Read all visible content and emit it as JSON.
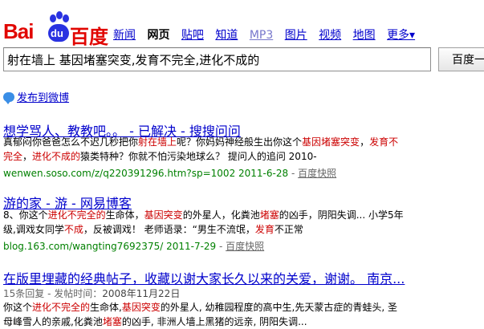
{
  "logo": {
    "bai": "Bai",
    "du": "du",
    "cn": "百度"
  },
  "nav": {
    "items": [
      "新闻",
      "网页",
      "贴吧",
      "知道",
      "MP3",
      "图片",
      "视频",
      "地图"
    ],
    "current": "网页",
    "more": "更多▾"
  },
  "search": {
    "query": "射在墙上 基因堵塞突变,发育不完全,进化不成的",
    "button": "百度一下"
  },
  "weibo": {
    "label": "发布到微博"
  },
  "results": [
    {
      "title": "想学骂人、教教吧。。 - 已解决 - 搜搜问问",
      "lines": [
        [
          [
            "真郁闷你爸爸怎么不迟几秒把你",
            ""
          ],
          [
            "射在墙上",
            "em"
          ],
          [
            "呢？你妈妈神经般生出你这个",
            ""
          ],
          [
            "基因堵塞突变",
            "em"
          ],
          [
            "，",
            ""
          ],
          [
            "发育不",
            "em"
          ]
        ],
        [
          [
            "完全",
            "em"
          ],
          [
            "，",
            ""
          ],
          [
            "进化不成的",
            "em"
          ],
          [
            "猿类特种？你就不怕污染地球么？ 提问人的追问 2010-",
            ""
          ]
        ]
      ],
      "url": "wenwen.soso.com/z/q220391296.htm?sp=1002 2011-6-28",
      "snapshot": "百度快照"
    },
    {
      "title": "游的家 - 游 - 网易博客",
      "lines": [
        [
          [
            "8、你这个",
            ""
          ],
          [
            "进化不完全的",
            "em"
          ],
          [
            "生命体，",
            ""
          ],
          [
            "基因突变",
            "em"
          ],
          [
            "的外星人，化粪池",
            ""
          ],
          [
            "堵塞",
            "em"
          ],
          [
            "的凶手，阴阳失调... 小学5年",
            ""
          ]
        ],
        [
          [
            "级,调戏女同学",
            ""
          ],
          [
            "不成",
            "em"
          ],
          [
            "，反被调戏！ 老师语录：“男生不流氓，",
            ""
          ],
          [
            "发育",
            "em"
          ],
          [
            "不正常",
            ""
          ]
        ]
      ],
      "url": "blog.163.com/wangting7692375/ 2011-7-29",
      "snapshot": "百度快照"
    },
    {
      "title": "在版里埋藏的经典帖子，收藏以谢大家长久以来的关爱，谢谢。 南京...",
      "meta_label": "15条回复 - 发帖时间：",
      "meta_value": "2008年11月22日",
      "lines": [
        [
          [
            "你这个",
            ""
          ],
          [
            "进化不完全的",
            "em"
          ],
          [
            "生命体,",
            ""
          ],
          [
            "基因突变",
            "em"
          ],
          [
            "的外星人, 幼稚园程度的高中生,先天蒙古症的青蛙头, 圣",
            ""
          ]
        ],
        [
          [
            "母峰雪人的亲戚,化粪池",
            ""
          ],
          [
            "堵塞",
            "em"
          ],
          [
            "的凶手, 非洲人墙上黑猪的远亲, 阴阳失调...",
            ""
          ]
        ]
      ]
    }
  ]
}
